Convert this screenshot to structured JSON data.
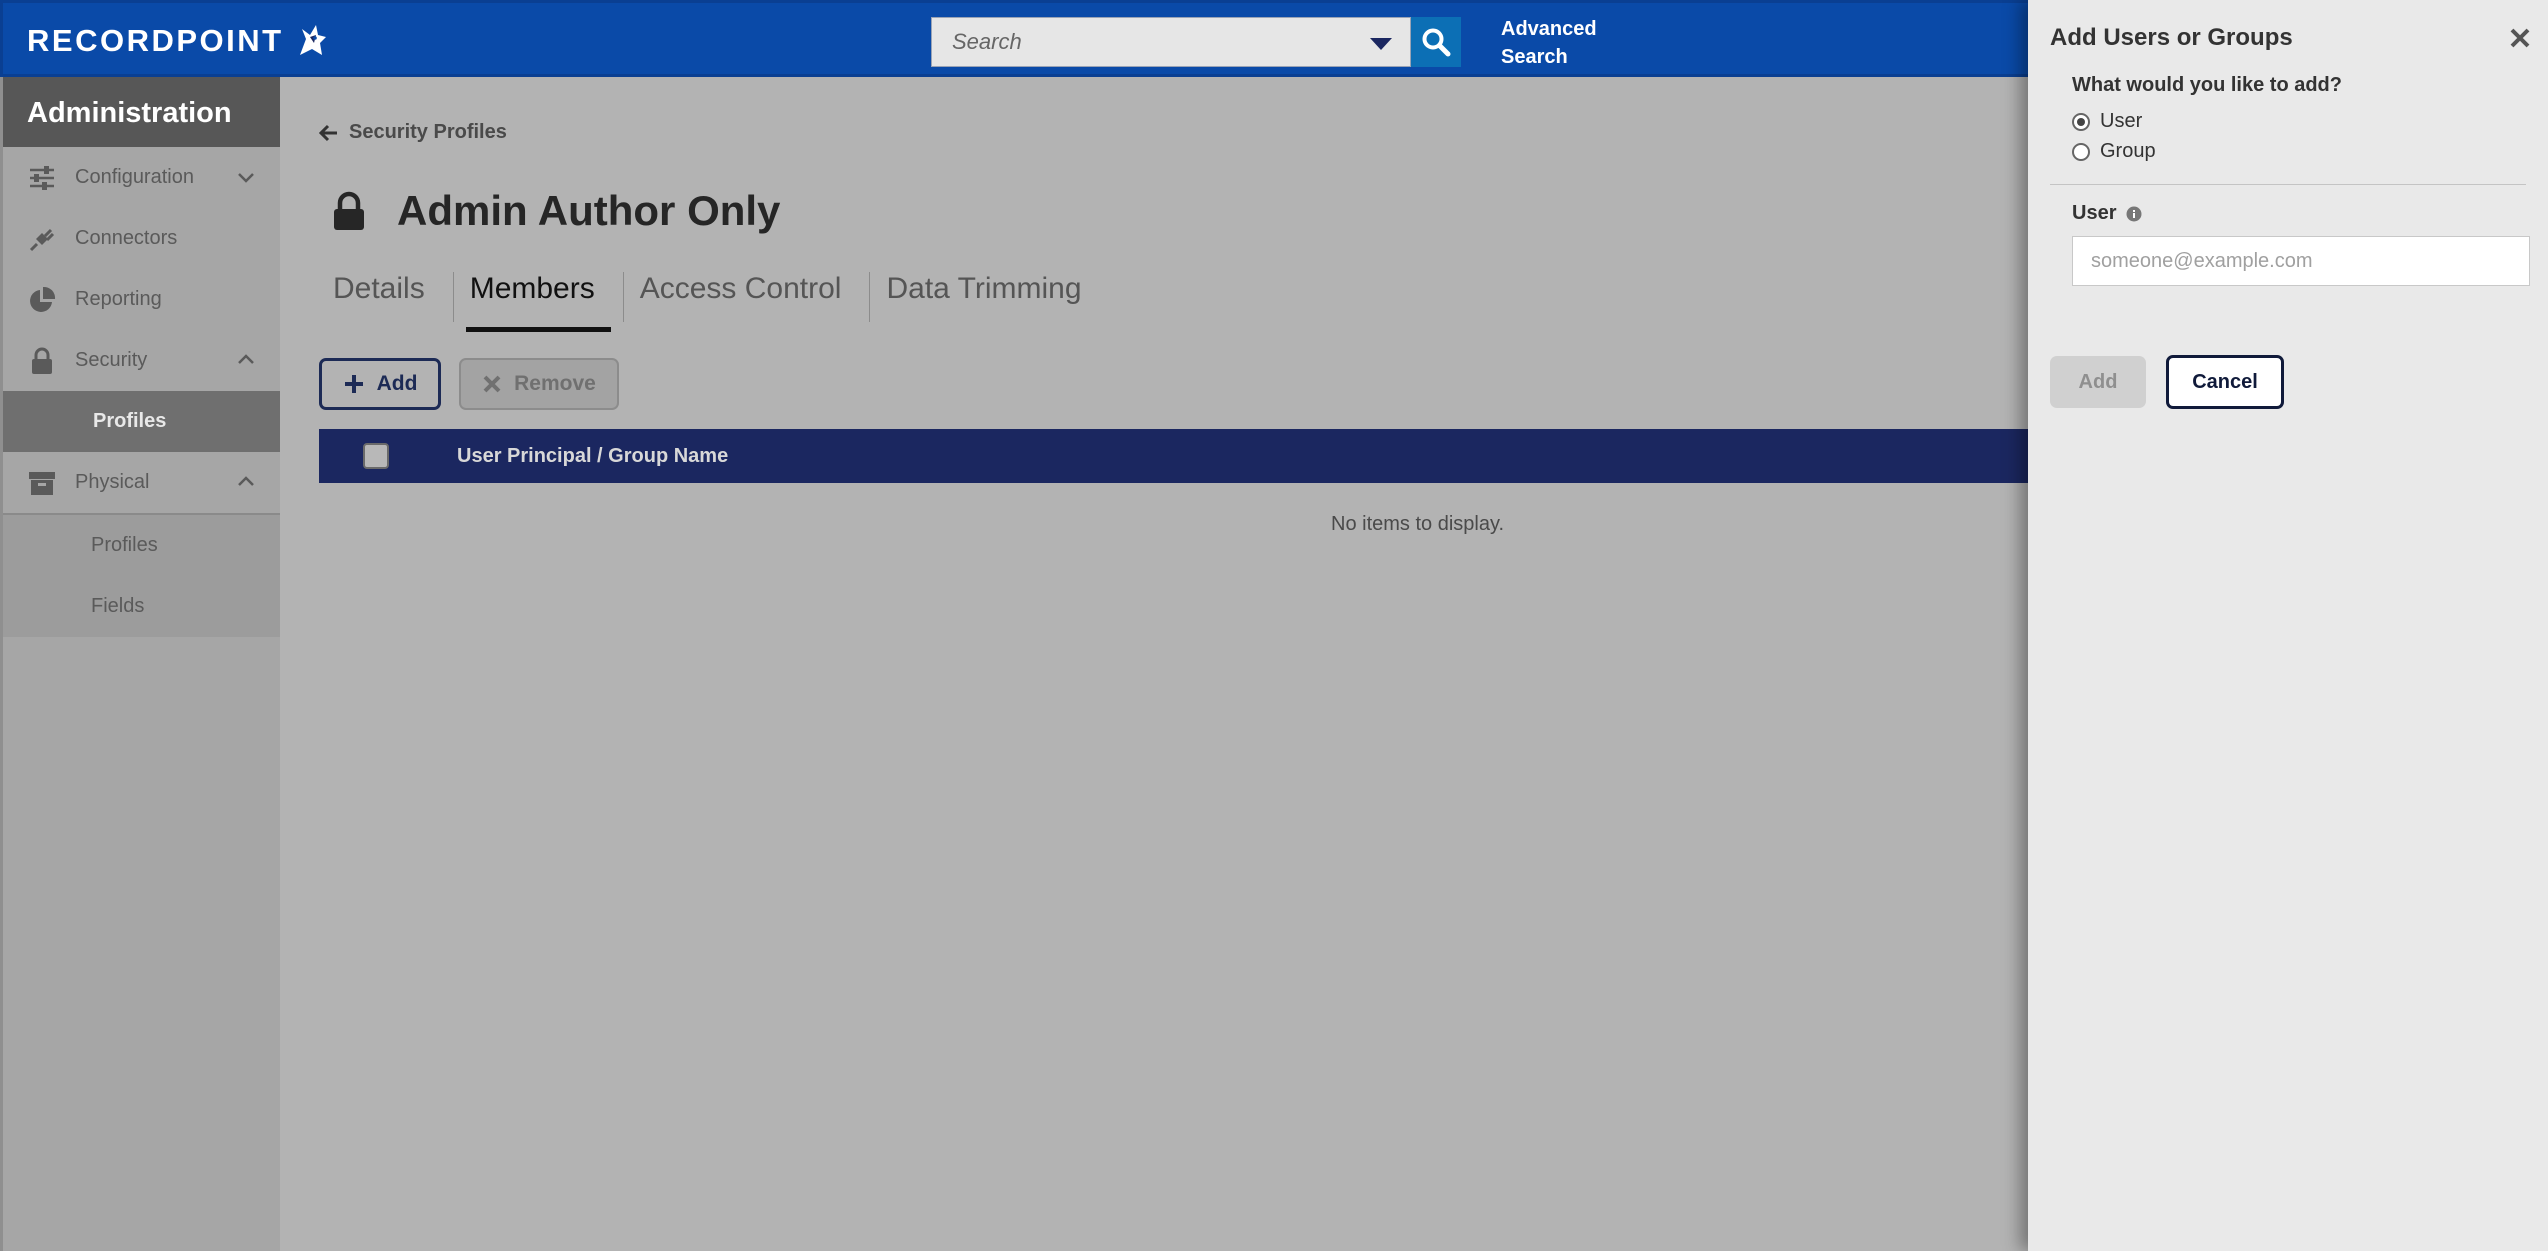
{
  "header": {
    "logo_text": "RECORDPOINT",
    "search_placeholder": "Search",
    "advanced_search_line1": "Advanced",
    "advanced_search_line2": "Search",
    "colors": {
      "bar": "#0a4aa8",
      "search_button": "#0c6fb5"
    }
  },
  "sidebar": {
    "title": "Administration",
    "items": [
      {
        "label": "Configuration",
        "icon": "sliders-icon",
        "chevron": "down"
      },
      {
        "label": "Connectors",
        "icon": "plug-icon"
      },
      {
        "label": "Reporting",
        "icon": "pie-chart-icon"
      },
      {
        "label": "Security",
        "icon": "lock-icon",
        "chevron": "up",
        "children": [
          {
            "label": "Profiles",
            "active": true
          }
        ]
      },
      {
        "label": "Physical",
        "icon": "archive-box-icon",
        "chevron": "up",
        "children": [
          {
            "label": "Profiles"
          },
          {
            "label": "Fields"
          }
        ]
      }
    ]
  },
  "main": {
    "breadcrumb": "Security Profiles",
    "title": "Admin Author Only",
    "tabs": [
      {
        "label": "Details"
      },
      {
        "label": "Members",
        "active": true
      },
      {
        "label": "Access Control"
      },
      {
        "label": "Data Trimming"
      }
    ],
    "add_label": "Add",
    "remove_label": "Remove",
    "table": {
      "column": "User Principal / Group Name",
      "empty_text": "No items to display."
    }
  },
  "panel": {
    "title": "Add Users or Groups",
    "question": "What would you like to add?",
    "options": [
      {
        "label": "User",
        "checked": true
      },
      {
        "label": "Group",
        "checked": false
      }
    ],
    "user_label": "User",
    "user_placeholder": "someone@example.com",
    "add_label": "Add",
    "cancel_label": "Cancel"
  }
}
